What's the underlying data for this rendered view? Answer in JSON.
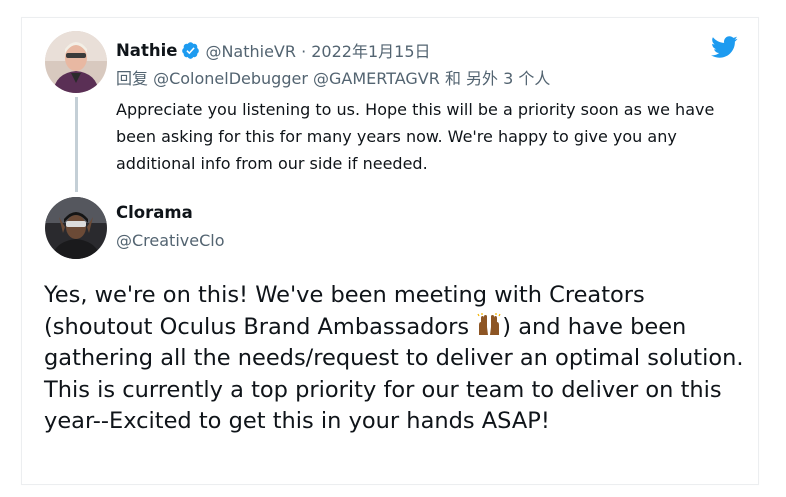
{
  "colors": {
    "twitter_blue": "#1d9bf0",
    "text_primary": "#0f1419",
    "text_secondary": "#536471",
    "thread_line": "#c4cfd6",
    "emoji_skin": "#8d5524"
  },
  "icons": {
    "brand": "twitter-bird-icon",
    "verified": "verified-badge-icon",
    "emoji": "raising-hands-emoji-icon"
  },
  "reply_tweet": {
    "author_name": "Nathie",
    "handle_time": "@NathieVR · 2022年1月15日",
    "replying_to": "回复 @ColonelDebugger @GAMERTAGVR 和 另外 3 个人",
    "text": "Appreciate you listening to us. Hope this will be a priority soon as we have been asking for this for many years now. We're happy to give you any additional info from our side if needed."
  },
  "main_tweet": {
    "author_name": "Clorama",
    "handle": "@CreativeClo",
    "text_before_emoji": "Yes, we're on this! We've been meeting with Creators (shoutout Oculus Brand Ambassadors ",
    "text_after_emoji": ") and have been gathering all the needs/request to deliver an optimal solution. This is currently a top priority for our team to deliver on this year--Excited to get this in your hands ASAP!"
  }
}
